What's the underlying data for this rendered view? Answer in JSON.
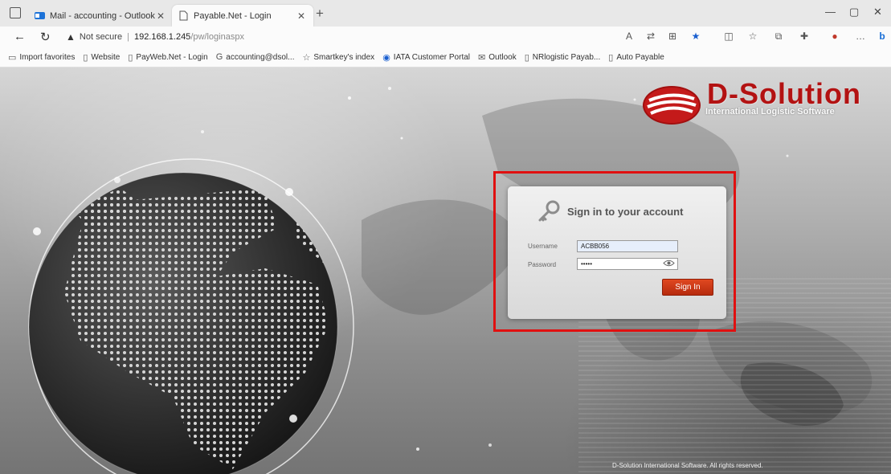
{
  "browser": {
    "tabs": [
      {
        "title": "Mail - accounting - Outlook",
        "active": false
      },
      {
        "title": "Payable.Net - Login",
        "active": true
      }
    ],
    "address": {
      "security": "Not secure",
      "host": "192.168.1.245",
      "path": "/pw/loginaspx"
    },
    "bookmarks": [
      {
        "label": "Import favorites",
        "icon": "folder-icon"
      },
      {
        "label": "Website",
        "icon": "page-icon"
      },
      {
        "label": "PayWeb.Net - Login",
        "icon": "page-icon"
      },
      {
        "label": "accounting@dsol...",
        "icon": "google-icon"
      },
      {
        "label": "Smartkey's index",
        "icon": "star-icon"
      },
      {
        "label": "IATA Customer Portal",
        "icon": "iata-icon"
      },
      {
        "label": "Outlook",
        "icon": "mail-icon"
      },
      {
        "label": "NRlogistic Payab...",
        "icon": "page-icon"
      },
      {
        "label": "Auto Payable",
        "icon": "page-icon"
      }
    ]
  },
  "brand": {
    "name": "D-Solution",
    "tagline": "International Logistic Software",
    "color": "#b31212"
  },
  "login": {
    "title": "Sign in to your account",
    "username_label": "Username",
    "username_value": "ACBB056",
    "password_label": "Password",
    "password_value": "•••••",
    "signin_label": "Sign In",
    "button_color": "#c83816"
  },
  "footer": "D-Solution International Software. All rights reserved."
}
